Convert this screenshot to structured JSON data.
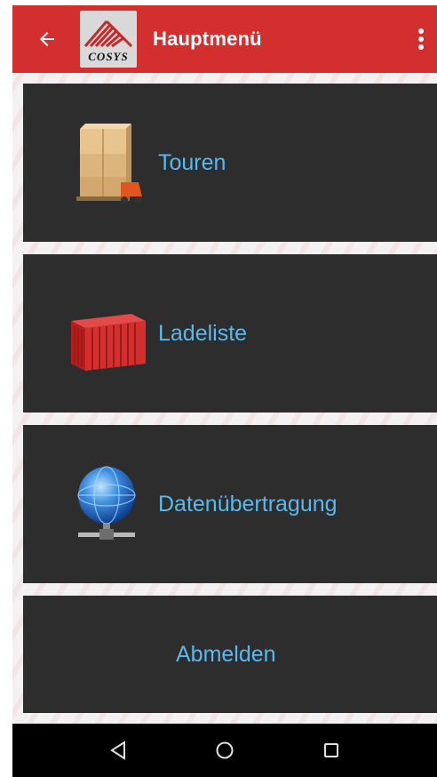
{
  "app": {
    "title": "Hauptmenü",
    "logo_text": "COSYS",
    "brand_color": "#d32f2f",
    "tile_color": "#2d2d2d",
    "label_color": "#5ab8ee"
  },
  "header": {
    "back_icon": "arrow-left-icon",
    "overflow_icon": "more-vert-icon"
  },
  "menu": {
    "items": [
      {
        "label": "Touren",
        "icon": "pallet-boxes-icon"
      },
      {
        "label": "Ladeliste",
        "icon": "shipping-container-icon"
      },
      {
        "label": "Datenübertragung",
        "icon": "network-globe-icon"
      },
      {
        "label": "Abmelden"
      }
    ]
  },
  "system_nav": {
    "back_icon": "nav-back-triangle-icon",
    "home_icon": "nav-home-circle-icon",
    "recents_icon": "nav-recents-square-icon"
  }
}
